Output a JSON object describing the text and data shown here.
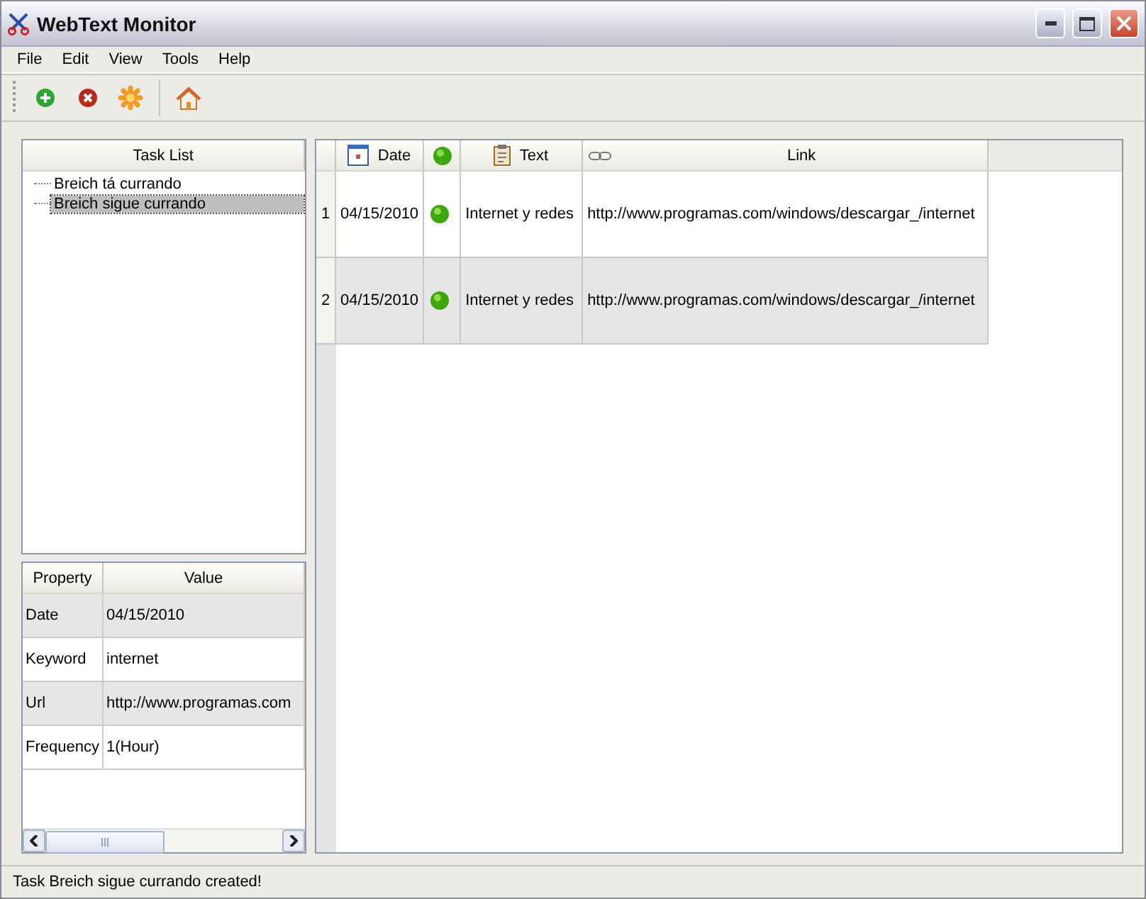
{
  "window": {
    "title": "WebText Monitor"
  },
  "menu": [
    "File",
    "Edit",
    "View",
    "Tools",
    "Help"
  ],
  "task_list": {
    "header": "Task List",
    "items": [
      {
        "label": "Breich tá currando",
        "selected": false
      },
      {
        "label": "Breich sigue currando",
        "selected": true
      }
    ]
  },
  "properties": {
    "columns": [
      "Property",
      "Value"
    ],
    "rows": [
      {
        "property": "Date",
        "value": "04/15/2010"
      },
      {
        "property": "Keyword",
        "value": "internet"
      },
      {
        "property": "Url",
        "value": "http://www.programas.com"
      },
      {
        "property": "Frequency",
        "value": "1(Hour)"
      }
    ]
  },
  "grid": {
    "columns": {
      "date": "Date",
      "text": "Text",
      "link": "Link"
    },
    "rows": [
      {
        "number": "1",
        "date": "04/15/2010",
        "text": "Internet y redes",
        "link": "http://www.programas.com/windows/descargar_/internet"
      },
      {
        "number": "2",
        "date": "04/15/2010",
        "text": "Internet y redes",
        "link": "http://www.programas.com/windows/descargar_/internet"
      }
    ]
  },
  "status_bar": "Task Breich sigue currando created!"
}
